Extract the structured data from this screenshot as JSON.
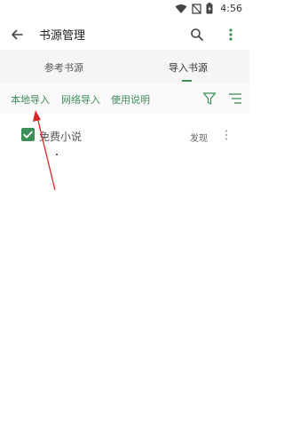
{
  "status_bar": {
    "time": "4:56"
  },
  "app_bar": {
    "title": "书源管理"
  },
  "tabs": [
    {
      "label": "参考书源",
      "active": false
    },
    {
      "label": "导入书源",
      "active": true
    }
  ],
  "actions": [
    {
      "label": "本地导入"
    },
    {
      "label": "网络导入"
    },
    {
      "label": "使用说明"
    }
  ],
  "sources": [
    {
      "name": "免费小说",
      "checked": true,
      "discover_label": "发现"
    }
  ],
  "colors": {
    "accent": "#3e8e5a",
    "annotation": "#d9262b"
  }
}
